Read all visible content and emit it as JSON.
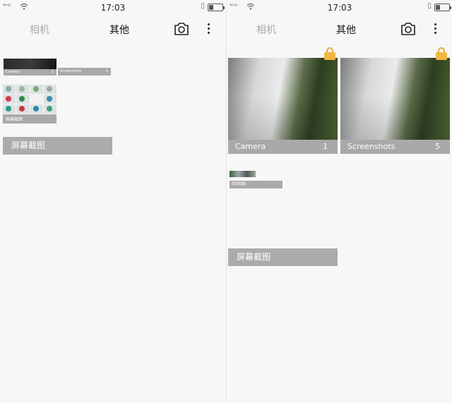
{
  "statusbar": {
    "signal_text": "*ᴴᴰ",
    "time": "17:03",
    "battery_level": 0.3
  },
  "toolbar": {
    "tab_camera": "相机",
    "tab_other": "其他"
  },
  "left_panel": {
    "mini_albums": [
      {
        "name": "Camera",
        "count": "1"
      },
      {
        "name": "Screenshots",
        "count": "5"
      }
    ],
    "screenshot_caption": "屏幕截图",
    "folder_label": "屏幕截图"
  },
  "right_panel": {
    "albums": [
      {
        "name": "Camera",
        "count": "1"
      },
      {
        "name": "Screenshots",
        "count": "5"
      }
    ],
    "small_caption": "屏幕截图",
    "folder_label": "屏幕截图"
  },
  "colors": {
    "caption_strip": "#a9a9a9",
    "lock": "#f0b545",
    "background": "#f7f7f7"
  },
  "icons": [
    "signal-icon",
    "wifi-icon",
    "vibrate-icon",
    "battery-icon",
    "camera-icon",
    "more-icon",
    "lock-icon"
  ]
}
